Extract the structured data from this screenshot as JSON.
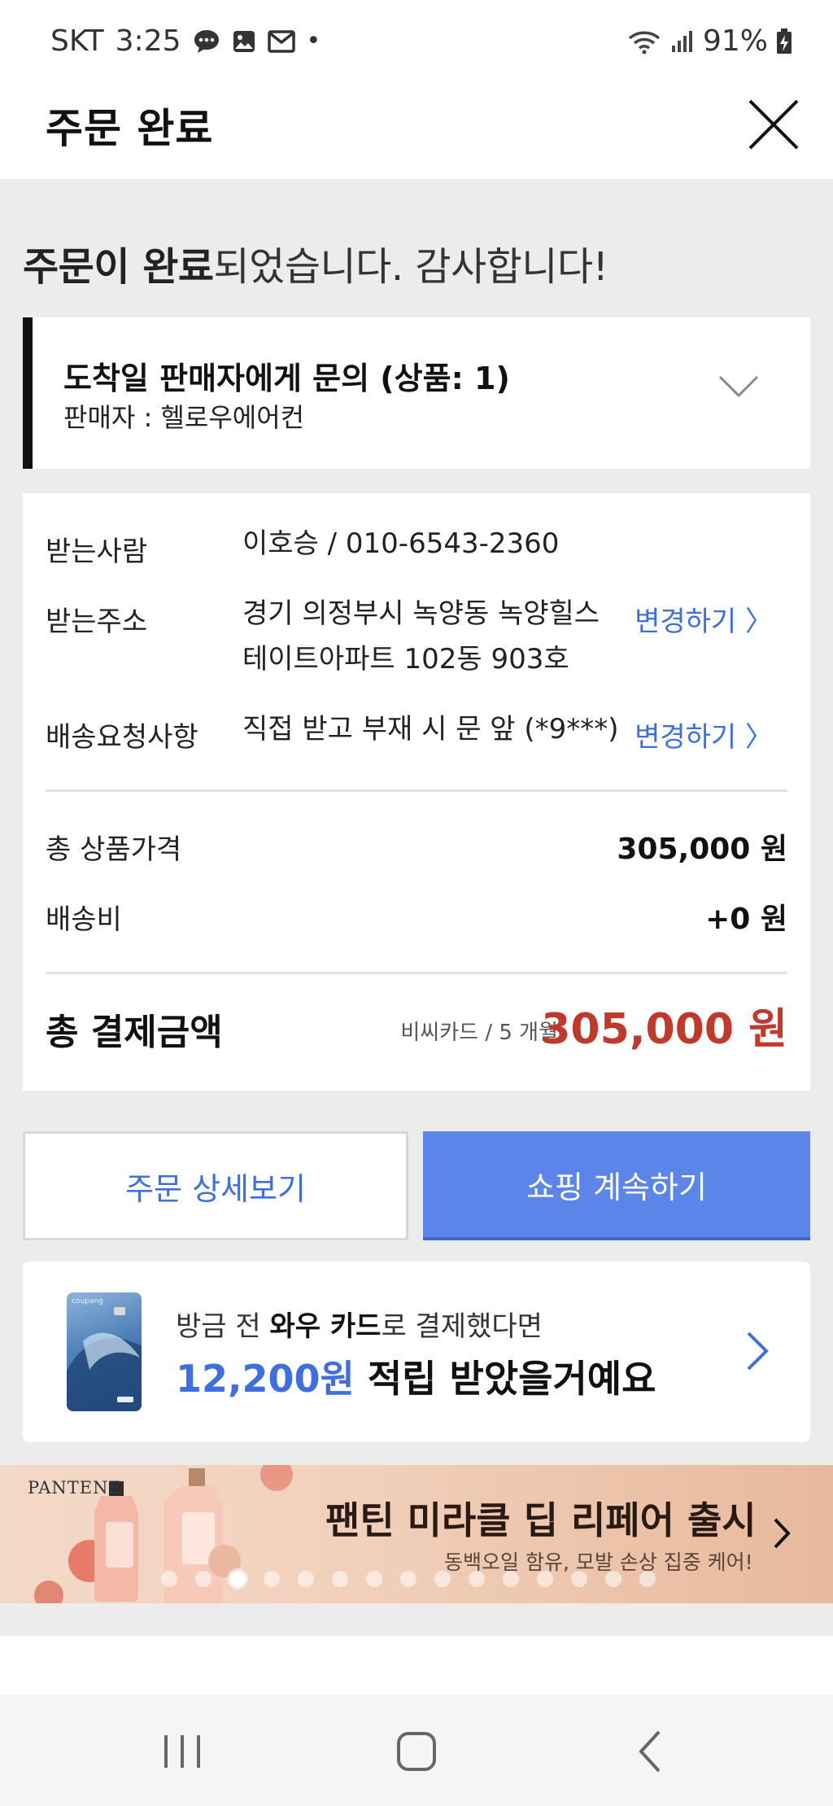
{
  "status_bar": {
    "carrier": "SKT",
    "time": "3:25",
    "dot": "•",
    "battery": "91%",
    "icons": [
      "chat-bubble-icon",
      "gallery-icon",
      "mail-icon",
      "wifi-icon",
      "signal-icon",
      "battery-charging-icon"
    ]
  },
  "header": {
    "title": "주문 완료",
    "close_icon": "close-icon"
  },
  "message": {
    "bold": "주문이 완료",
    "rest": "되었습니다. 감사합니다!"
  },
  "seller": {
    "title": "도착일 판매자에게 문의 (상품: 1)",
    "subtitle": "판매자 : 헬로우에어컨",
    "expand_icon": "chevron-down-icon"
  },
  "shipping": {
    "recipient_label": "받는사람",
    "recipient_value": "이호승 / 010-6543-2360",
    "address_label": "받는주소",
    "address_line1": "경기 의정부시 녹양동 녹양힐스",
    "address_line2": "테이트아파트 102동 903호",
    "address_change": "변경하기 〉",
    "request_label": "배송요청사항",
    "request_value": "직접 받고 부재 시 문 앞 (*9***)",
    "request_change": "변경하기 〉"
  },
  "pricing": {
    "product_total_label": "총 상품가격",
    "product_total_value": "305,000 원",
    "shipping_fee_label": "배송비",
    "shipping_fee_value": "+0 원",
    "grand_total_label": "총 결제금액",
    "payment_method": "비씨카드 / 5 개월",
    "grand_total_value": "305,000 원",
    "total_color": "#c0392b"
  },
  "buttons": {
    "order_detail": "주문 상세보기",
    "continue_shopping": "쇼핑 계속하기",
    "accent": "#5b85e8"
  },
  "promo": {
    "line1_prefix": "방금 전 ",
    "line1_bold": "와우 카드",
    "line1_suffix": "로 결제했다면",
    "amount": "12,200원",
    "line2_suffix": " 적립 받았을거예요",
    "card_label": "coupang",
    "arrow_icon": "chevron-right-icon"
  },
  "banner": {
    "brand": "PANTENE",
    "title": "팬틴 미라클 딥 리페어 출시",
    "subtitle": "동백오일 함유, 모발 손상 집중 케어!",
    "dot_count": 15,
    "active_dot": 2
  },
  "nav_bar": {
    "icons": [
      "recent-apps-icon",
      "home-icon",
      "back-icon"
    ]
  }
}
